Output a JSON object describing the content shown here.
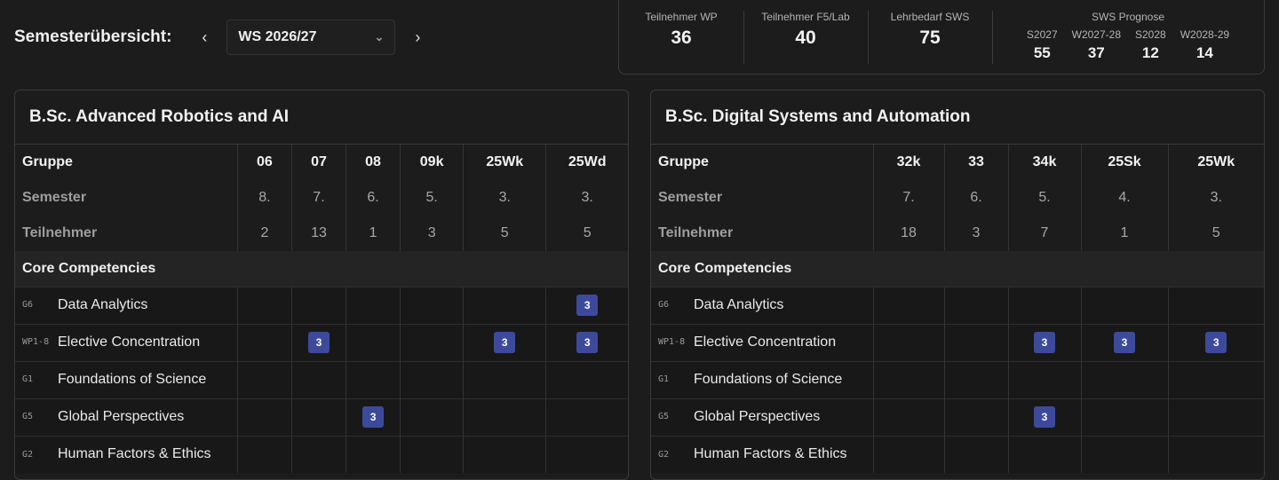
{
  "header": {
    "title": "Semesterübersicht:",
    "prev_icon": "‹",
    "next_icon": "›",
    "semester_value": "WS 2026/27",
    "dropdown_icon": "⌄"
  },
  "stats": {
    "wp": {
      "label": "Teilnehmer WP",
      "value": "36"
    },
    "lab": {
      "label": "Teilnehmer F5/Lab",
      "value": "40"
    },
    "sws": {
      "label": "Lehrbedarf SWS",
      "value": "75"
    },
    "prognose": {
      "label": "SWS Prognose",
      "cols": [
        {
          "term": "S2027",
          "value": "55"
        },
        {
          "term": "W2027-28",
          "value": "37"
        },
        {
          "term": "S2028",
          "value": "12"
        },
        {
          "term": "W2028-29",
          "value": "14"
        }
      ]
    }
  },
  "panels": [
    {
      "title": "B.Sc. Advanced Robotics and AI",
      "row_labels": {
        "group": "Gruppe",
        "semester": "Semester",
        "participants": "Teilnehmer"
      },
      "section": "Core Competencies",
      "groups": [
        {
          "name": "06",
          "semester": "8.",
          "participants": "2"
        },
        {
          "name": "07",
          "semester": "7.",
          "participants": "13"
        },
        {
          "name": "08",
          "semester": "6.",
          "participants": "1"
        },
        {
          "name": "09k",
          "semester": "5.",
          "participants": "3"
        },
        {
          "name": "25Wk",
          "semester": "3.",
          "participants": "5"
        },
        {
          "name": "25Wd",
          "semester": "3.",
          "participants": "5"
        }
      ],
      "courses": [
        {
          "code": "G6",
          "name": "Data Analytics",
          "cells": [
            "",
            "",
            "",
            "",
            "",
            "3"
          ]
        },
        {
          "code": "WP1-8",
          "name": "Elective Concentration",
          "cells": [
            "",
            "3",
            "",
            "",
            "3",
            "3"
          ]
        },
        {
          "code": "G1",
          "name": "Foundations of Science",
          "cells": [
            "",
            "",
            "",
            "",
            "",
            ""
          ]
        },
        {
          "code": "G5",
          "name": "Global Perspectives",
          "cells": [
            "",
            "",
            "3",
            "",
            "",
            ""
          ]
        },
        {
          "code": "G2",
          "name": "Human Factors & Ethics",
          "cells": [
            "",
            "",
            "",
            "",
            "",
            ""
          ]
        }
      ]
    },
    {
      "title": "B.Sc. Digital Systems and Automation",
      "row_labels": {
        "group": "Gruppe",
        "semester": "Semester",
        "participants": "Teilnehmer"
      },
      "section": "Core Competencies",
      "groups": [
        {
          "name": "32k",
          "semester": "7.",
          "participants": "18"
        },
        {
          "name": "33",
          "semester": "6.",
          "participants": "3"
        },
        {
          "name": "34k",
          "semester": "5.",
          "participants": "7"
        },
        {
          "name": "25Sk",
          "semester": "4.",
          "participants": "1"
        },
        {
          "name": "25Wk",
          "semester": "3.",
          "participants": "5"
        }
      ],
      "courses": [
        {
          "code": "G6",
          "name": "Data Analytics",
          "cells": [
            "",
            "",
            "",
            "",
            ""
          ]
        },
        {
          "code": "WP1-8",
          "name": "Elective Concentration",
          "cells": [
            "",
            "",
            "3",
            "3",
            "3"
          ]
        },
        {
          "code": "G1",
          "name": "Foundations of Science",
          "cells": [
            "",
            "",
            "",
            "",
            ""
          ]
        },
        {
          "code": "G5",
          "name": "Global Perspectives",
          "cells": [
            "",
            "",
            "3",
            "",
            ""
          ]
        },
        {
          "code": "G2",
          "name": "Human Factors & Ethics",
          "cells": [
            "",
            "",
            "",
            "",
            ""
          ]
        }
      ]
    }
  ],
  "colors": {
    "badge": "#3d4a9c",
    "background": "#1c1c1c"
  }
}
